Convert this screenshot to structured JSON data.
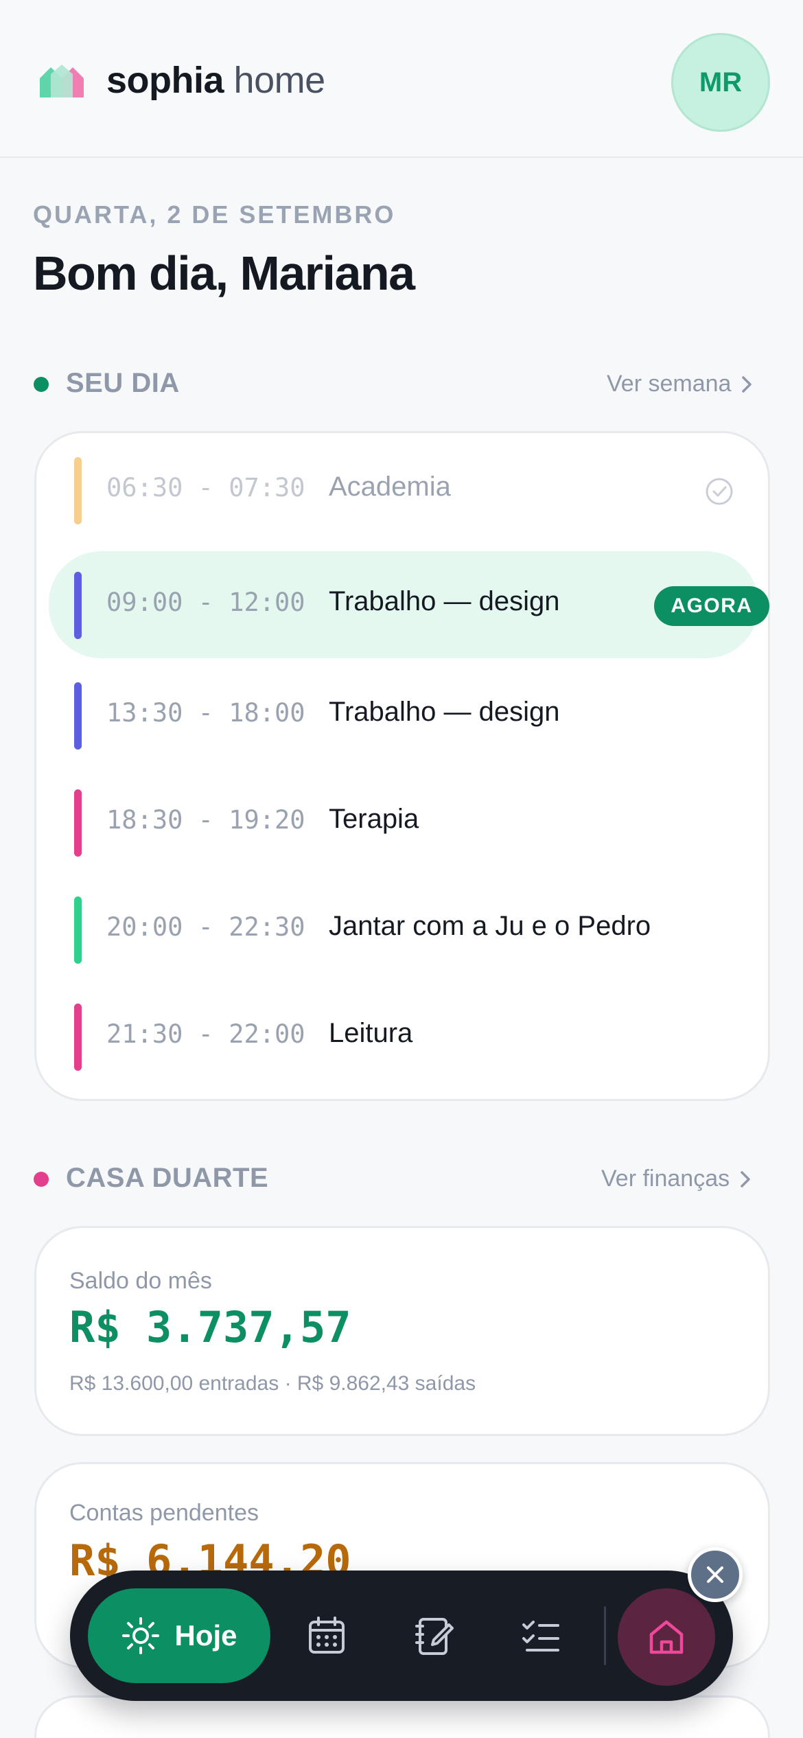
{
  "app": {
    "name_bold": "sophia",
    "name_light": "home"
  },
  "user": {
    "initials": "MR"
  },
  "date_label": "QUARTA, 2 DE SETEMBRO",
  "greeting": "Bom dia, Mariana",
  "day_section": {
    "title": "SEU DIA",
    "link": "Ver semana",
    "dot_color": "#0c8f63",
    "events": [
      {
        "time": "06:30 - 07:30",
        "title": "Academia",
        "color": "#f7cf8d",
        "state": "done"
      },
      {
        "time": "09:00 - 12:00",
        "title": "Trabalho — design",
        "color": "#5b5fe0",
        "state": "now",
        "badge": "AGORA"
      },
      {
        "time": "13:30 - 18:00",
        "title": "Trabalho — design",
        "color": "#5b5fe0",
        "state": "upcoming"
      },
      {
        "time": "18:30 - 19:20",
        "title": "Terapia",
        "color": "#e33f8c",
        "state": "upcoming"
      },
      {
        "time": "20:00 - 22:30",
        "title": "Jantar com a Ju e o Pedro",
        "color": "#2fcf8c",
        "state": "upcoming"
      },
      {
        "time": "21:30 - 22:00",
        "title": "Leitura",
        "color": "#e33f8c",
        "state": "upcoming"
      }
    ]
  },
  "house_section": {
    "title": "CASA DUARTE",
    "link": "Ver finanças",
    "dot_color": "#e33f8c",
    "balance": {
      "label": "Saldo do mês",
      "value": "R$ 3.737,57",
      "color": "#0c8f63",
      "subtitle": "R$ 13.600,00 entradas · R$ 9.862,43 saídas"
    },
    "pending": {
      "label": "Contas pendentes",
      "value": "R$ 6.144,20",
      "color": "#b86a0b"
    }
  },
  "nav": {
    "today_label": "Hoje",
    "items": [
      "sun-icon",
      "calendar-icon",
      "notebook-icon",
      "checklist-icon",
      "home-icon"
    ],
    "accent": "#0c8f63"
  }
}
